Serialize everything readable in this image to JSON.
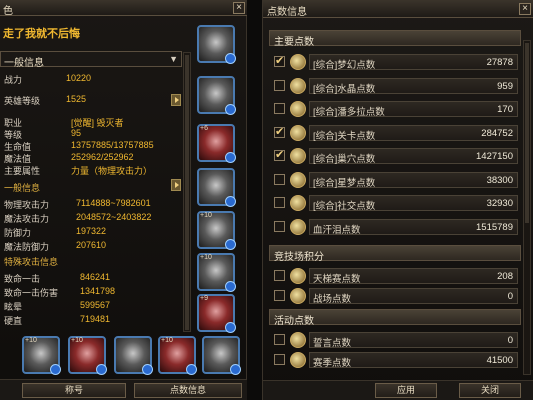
{
  "left": {
    "title": "色",
    "char_name": "走了我就不后悔",
    "dropdown_value": "一般信息",
    "stats_basic": [
      {
        "key": "战力",
        "value": "10220"
      },
      {
        "key": "英雄等级",
        "value": "1525"
      }
    ],
    "stats_class": [
      {
        "key": "职业",
        "value": "[觉醒] 毁灭者"
      },
      {
        "key": "等级",
        "value": "95"
      },
      {
        "key": "生命值",
        "value": "13757885/13757885"
      },
      {
        "key": "魔法值",
        "value": "252962/252962"
      },
      {
        "key": "主要属性",
        "value": "力量（物理攻击力）"
      }
    ],
    "section_general": "一般信息",
    "stats_attack": [
      {
        "key": "物理攻击力",
        "value": "7114888~7982601"
      },
      {
        "key": "魔法攻击力",
        "value": "2048572~2403822"
      },
      {
        "key": "防御力",
        "value": "197322"
      },
      {
        "key": "魔法防御力",
        "value": "207610"
      }
    ],
    "section_special": "特殊攻击信息",
    "stats_special": [
      {
        "key": "致命一击",
        "value": "846241"
      },
      {
        "key": "致命一击伤害",
        "value": "1341798"
      },
      {
        "key": "眩晕",
        "value": "599567"
      },
      {
        "key": "硬直",
        "value": "719481"
      }
    ],
    "slot_plus": [
      "+6",
      "+10",
      "+10",
      "+9",
      "+10",
      "+10",
      "+10"
    ],
    "buttons": {
      "title_btn": "称号",
      "points_btn": "点数信息"
    }
  },
  "right": {
    "title": "点数信息",
    "sections": {
      "main": "主要点数",
      "arena": "竞技场积分",
      "activity": "活动点数"
    },
    "main_points": [
      {
        "label": "[综合]梦幻点数",
        "value": "27878",
        "checked": true
      },
      {
        "label": "[综合]水晶点数",
        "value": "959",
        "checked": false
      },
      {
        "label": "[综合]潘多拉点数",
        "value": "170",
        "checked": false
      },
      {
        "label": "[综合]关卡点数",
        "value": "284752",
        "checked": true
      },
      {
        "label": "[综合]巢穴点数",
        "value": "1427150",
        "checked": true
      },
      {
        "label": "[综合]星梦点数",
        "value": "38300",
        "checked": false
      },
      {
        "label": "[综合]社交点数",
        "value": "32930",
        "checked": false
      },
      {
        "label": "血汗泪点数",
        "value": "1515789",
        "checked": false
      }
    ],
    "arena_points": [
      {
        "label": "天梯赛点数",
        "value": "208",
        "checked": false
      },
      {
        "label": "战场点数",
        "value": "0",
        "checked": false
      }
    ],
    "activity_points": [
      {
        "label": "誓言点数",
        "value": "0",
        "checked": false
      },
      {
        "label": "赛季点数",
        "value": "41500",
        "checked": false
      }
    ],
    "buttons": {
      "apply": "应用",
      "close": "关闭"
    }
  },
  "colors": {
    "accent_gold": "#f0b830",
    "slot_border": "#4a7ab0",
    "panel_bg": "#1a1714"
  },
  "icons": {
    "close": "close-icon",
    "arrow": "arrow-right-icon",
    "checkbox": "checkbox-icon",
    "gear": "gear-icon"
  }
}
